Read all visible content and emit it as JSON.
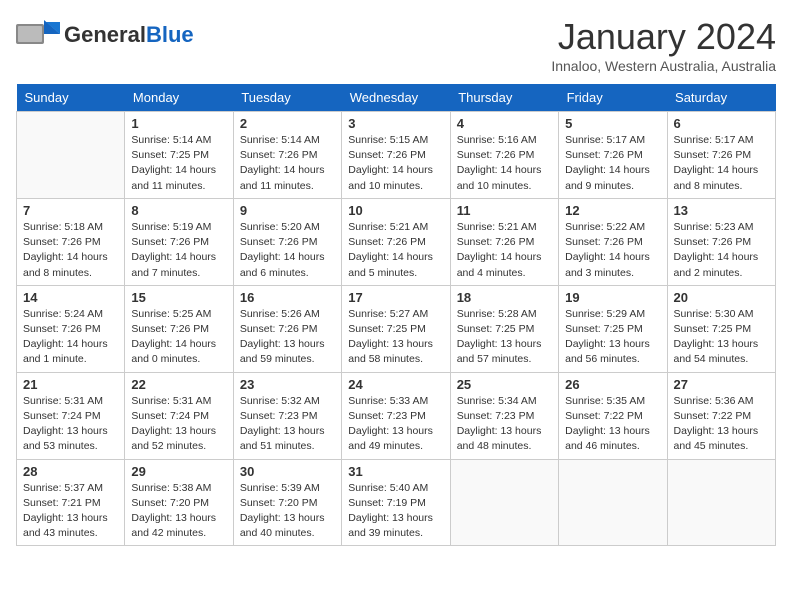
{
  "header": {
    "logo_general": "General",
    "logo_blue": "Blue",
    "month": "January 2024",
    "location": "Innaloo, Western Australia, Australia"
  },
  "weekdays": [
    "Sunday",
    "Monday",
    "Tuesday",
    "Wednesday",
    "Thursday",
    "Friday",
    "Saturday"
  ],
  "weeks": [
    [
      {
        "day": null,
        "info": null
      },
      {
        "day": "1",
        "sunrise": "5:14 AM",
        "sunset": "7:25 PM",
        "daylight": "14 hours and 11 minutes."
      },
      {
        "day": "2",
        "sunrise": "5:14 AM",
        "sunset": "7:26 PM",
        "daylight": "14 hours and 11 minutes."
      },
      {
        "day": "3",
        "sunrise": "5:15 AM",
        "sunset": "7:26 PM",
        "daylight": "14 hours and 10 minutes."
      },
      {
        "day": "4",
        "sunrise": "5:16 AM",
        "sunset": "7:26 PM",
        "daylight": "14 hours and 10 minutes."
      },
      {
        "day": "5",
        "sunrise": "5:17 AM",
        "sunset": "7:26 PM",
        "daylight": "14 hours and 9 minutes."
      },
      {
        "day": "6",
        "sunrise": "5:17 AM",
        "sunset": "7:26 PM",
        "daylight": "14 hours and 8 minutes."
      }
    ],
    [
      {
        "day": "7",
        "sunrise": "5:18 AM",
        "sunset": "7:26 PM",
        "daylight": "14 hours and 8 minutes."
      },
      {
        "day": "8",
        "sunrise": "5:19 AM",
        "sunset": "7:26 PM",
        "daylight": "14 hours and 7 minutes."
      },
      {
        "day": "9",
        "sunrise": "5:20 AM",
        "sunset": "7:26 PM",
        "daylight": "14 hours and 6 minutes."
      },
      {
        "day": "10",
        "sunrise": "5:21 AM",
        "sunset": "7:26 PM",
        "daylight": "14 hours and 5 minutes."
      },
      {
        "day": "11",
        "sunrise": "5:21 AM",
        "sunset": "7:26 PM",
        "daylight": "14 hours and 4 minutes."
      },
      {
        "day": "12",
        "sunrise": "5:22 AM",
        "sunset": "7:26 PM",
        "daylight": "14 hours and 3 minutes."
      },
      {
        "day": "13",
        "sunrise": "5:23 AM",
        "sunset": "7:26 PM",
        "daylight": "14 hours and 2 minutes."
      }
    ],
    [
      {
        "day": "14",
        "sunrise": "5:24 AM",
        "sunset": "7:26 PM",
        "daylight": "14 hours and 1 minute."
      },
      {
        "day": "15",
        "sunrise": "5:25 AM",
        "sunset": "7:26 PM",
        "daylight": "14 hours and 0 minutes."
      },
      {
        "day": "16",
        "sunrise": "5:26 AM",
        "sunset": "7:26 PM",
        "daylight": "13 hours and 59 minutes."
      },
      {
        "day": "17",
        "sunrise": "5:27 AM",
        "sunset": "7:25 PM",
        "daylight": "13 hours and 58 minutes."
      },
      {
        "day": "18",
        "sunrise": "5:28 AM",
        "sunset": "7:25 PM",
        "daylight": "13 hours and 57 minutes."
      },
      {
        "day": "19",
        "sunrise": "5:29 AM",
        "sunset": "7:25 PM",
        "daylight": "13 hours and 56 minutes."
      },
      {
        "day": "20",
        "sunrise": "5:30 AM",
        "sunset": "7:25 PM",
        "daylight": "13 hours and 54 minutes."
      }
    ],
    [
      {
        "day": "21",
        "sunrise": "5:31 AM",
        "sunset": "7:24 PM",
        "daylight": "13 hours and 53 minutes."
      },
      {
        "day": "22",
        "sunrise": "5:31 AM",
        "sunset": "7:24 PM",
        "daylight": "13 hours and 52 minutes."
      },
      {
        "day": "23",
        "sunrise": "5:32 AM",
        "sunset": "7:23 PM",
        "daylight": "13 hours and 51 minutes."
      },
      {
        "day": "24",
        "sunrise": "5:33 AM",
        "sunset": "7:23 PM",
        "daylight": "13 hours and 49 minutes."
      },
      {
        "day": "25",
        "sunrise": "5:34 AM",
        "sunset": "7:23 PM",
        "daylight": "13 hours and 48 minutes."
      },
      {
        "day": "26",
        "sunrise": "5:35 AM",
        "sunset": "7:22 PM",
        "daylight": "13 hours and 46 minutes."
      },
      {
        "day": "27",
        "sunrise": "5:36 AM",
        "sunset": "7:22 PM",
        "daylight": "13 hours and 45 minutes."
      }
    ],
    [
      {
        "day": "28",
        "sunrise": "5:37 AM",
        "sunset": "7:21 PM",
        "daylight": "13 hours and 43 minutes."
      },
      {
        "day": "29",
        "sunrise": "5:38 AM",
        "sunset": "7:20 PM",
        "daylight": "13 hours and 42 minutes."
      },
      {
        "day": "30",
        "sunrise": "5:39 AM",
        "sunset": "7:20 PM",
        "daylight": "13 hours and 40 minutes."
      },
      {
        "day": "31",
        "sunrise": "5:40 AM",
        "sunset": "7:19 PM",
        "daylight": "13 hours and 39 minutes."
      },
      {
        "day": null,
        "info": null
      },
      {
        "day": null,
        "info": null
      },
      {
        "day": null,
        "info": null
      }
    ]
  ],
  "labels": {
    "sunrise": "Sunrise:",
    "sunset": "Sunset:",
    "daylight": "Daylight:"
  }
}
